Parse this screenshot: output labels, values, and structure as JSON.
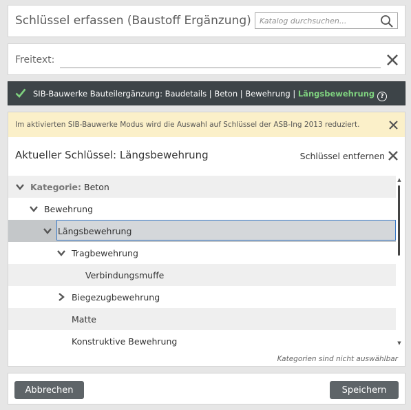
{
  "header": {
    "title": "Schlüssel erfassen (Baustoff Ergänzung)",
    "search_placeholder": "Katalog durchsuchen..."
  },
  "freitext": {
    "label": "Freitext:",
    "value": ""
  },
  "path": {
    "prefix": "SIB-Bauwerke Bauteilergänzung: Baudetails | Beton | Bewehrung | ",
    "active": "Längsbewehrung",
    "help_glyph": "?"
  },
  "notice": {
    "text": "Im aktivierten SIB-Bauwerke Modus wird die Auswahl auf Schlüssel der ASB-Ing 2013 reduziert."
  },
  "current": {
    "title": "Aktueller Schlüssel: Längsbewehrung",
    "remove_label": "Schlüssel entfernen"
  },
  "tree": {
    "category_prefix": "Kategorie:",
    "rows": [
      {
        "label": "Beton",
        "indent": 0,
        "expander": "expanded",
        "category": true
      },
      {
        "label": "Bewehrung",
        "indent": 1,
        "expander": "expanded"
      },
      {
        "label": "Längsbewehrung",
        "indent": 2,
        "expander": "expanded",
        "selected": true
      },
      {
        "label": "Tragbewehrung",
        "indent": 3,
        "expander": "expanded"
      },
      {
        "label": "Verbindungsmuffe",
        "indent": 4,
        "expander": "none"
      },
      {
        "label": "Biegezugbewehrung",
        "indent": 3,
        "expander": "collapsed"
      },
      {
        "label": "Matte",
        "indent": 3,
        "expander": "none"
      },
      {
        "label": "Konstruktive Bewehrung",
        "indent": 3,
        "expander": "none"
      }
    ],
    "hint": "Kategorien sind nicht auswählbar"
  },
  "footer": {
    "cancel_label": "Abbrechen",
    "save_label": "Speichern"
  },
  "icons": {
    "search": "search-icon",
    "close": "close-icon",
    "check": "check-icon",
    "help": "help-icon",
    "chevron_down": "chevron-down-icon",
    "chevron_right": "chevron-right-icon"
  },
  "colors": {
    "path_bar_bg": "#3d4448",
    "path_active": "#7fd27f",
    "notice_bg": "#fbf0c9",
    "button_bg": "#5e6468",
    "selection_border": "#3a7ac7"
  }
}
